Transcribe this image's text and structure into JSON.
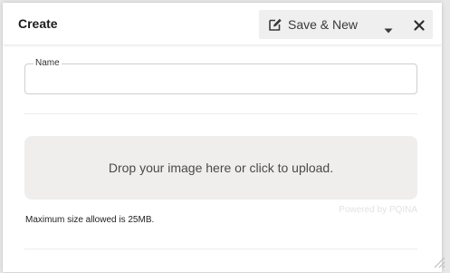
{
  "header": {
    "title": "Create",
    "save_label": "Save & New",
    "icons": {
      "save": "edit-icon",
      "dropdown": "caret-down-icon",
      "close": "close-icon"
    }
  },
  "form": {
    "name_field": {
      "label": "Name",
      "value": "",
      "placeholder": ""
    },
    "upload": {
      "dropzone_text": "Drop your image here or click to upload.",
      "powered_by": "Powered by PQINA",
      "helper_text": "Maximum size allowed is 25MB."
    }
  },
  "colors": {
    "accent_bg": "#efefef",
    "dropzone_bg": "#efeeec",
    "text": "#3a3a3a"
  }
}
